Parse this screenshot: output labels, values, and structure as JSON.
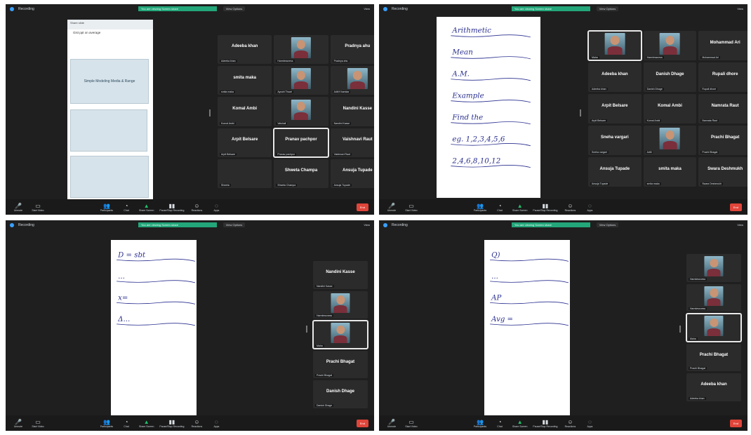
{
  "meeting": {
    "app_label": "Recording",
    "view_pill": "View Options",
    "view_right": "View",
    "share_banner": "You are viewing Screen share"
  },
  "panels": [
    {
      "id": "tl",
      "slides": {
        "header": "Share slide",
        "title": "Gist ppt on average",
        "slide_text": "Simple Modeling Media & Range",
        "second_text": "",
        "third_text": ""
      },
      "tiles": [
        {
          "name": "Adeeba khan",
          "label": "Adeeba khan",
          "video": false
        },
        {
          "name": "",
          "label": "Harmlessness",
          "video": true
        },
        {
          "name": "Pradnya ahu",
          "label": "Pradnya ahu",
          "video": false
        },
        {
          "name": "smita maka",
          "label": "smita maka",
          "video": false
        },
        {
          "name": "",
          "label": "Ayushi Tiwari",
          "video": true
        },
        {
          "name": "",
          "label": "Aditi Khamkar",
          "video": true
        },
        {
          "name": "Komal Ambi",
          "label": "Komal Ambi",
          "video": false
        },
        {
          "name": "",
          "label": "Vaishali",
          "video": true
        },
        {
          "name": "Nandini Kasse",
          "label": "Nandini Kasse",
          "video": false
        },
        {
          "name": "Arpit Belsare",
          "label": "Arpit Belsare",
          "video": false
        },
        {
          "name": "Pranav pachpor",
          "label": "Pranav pachpor",
          "video": false,
          "active": true
        },
        {
          "name": "Vaishnavi Raut",
          "label": "Vaishnavi Raut",
          "video": false
        },
        {
          "name": "",
          "label": "Shweta",
          "video": false
        },
        {
          "name": "Shweta Champa",
          "label": "Shweta Champa",
          "video": false
        },
        {
          "name": "Ansuja Tupade",
          "label": "Ansuja Tupade",
          "video": false
        }
      ]
    },
    {
      "id": "tr",
      "whiteboard": [
        "Arithmetic",
        "Mean",
        "A.M.",
        "Example",
        "Find the",
        "eg. 1,2,3,4,5,6",
        "2,4,6,8,10,12"
      ],
      "tiles": [
        {
          "name": "",
          "label": "Maha",
          "video": true,
          "active": true
        },
        {
          "name": "",
          "label": "Harmlessness",
          "video": true
        },
        {
          "name": "Mohammad Ari",
          "label": "Mohammad Ari",
          "video": false
        },
        {
          "name": "Adeeba khan",
          "label": "Adeeba khan",
          "video": false
        },
        {
          "name": "Danish Dhage",
          "label": "Danish Dhage",
          "video": false
        },
        {
          "name": "Rupali dhore",
          "label": "Rupali dhore",
          "video": false
        },
        {
          "name": "Arpit Belsare",
          "label": "Arpit Belsare",
          "video": false
        },
        {
          "name": "Komal Ambi",
          "label": "Komal Ambi",
          "video": false
        },
        {
          "name": "Namrata Raut",
          "label": "Namrata Raut",
          "video": false
        },
        {
          "name": "Sneha vargari",
          "label": "Sneha vargari",
          "video": false
        },
        {
          "name": "",
          "label": "Aditi",
          "video": true
        },
        {
          "name": "Prachi Bhagat",
          "label": "Prachi Bhagat",
          "video": false
        },
        {
          "name": "Ansuja Tupade",
          "label": "Ansuja Tupade",
          "video": false
        },
        {
          "name": "smita maka",
          "label": "smita maka",
          "video": false
        },
        {
          "name": "Swara Deshmukh",
          "label": "Swara Deshmukh",
          "video": false
        }
      ]
    },
    {
      "id": "bl",
      "whiteboard": [
        "D = sbt",
        "...",
        "x=",
        "Δ..."
      ],
      "tiles": [
        {
          "name": "Nandini Kasse",
          "label": "Nandini Kasse",
          "video": false
        },
        {
          "name": "",
          "label": "Harmlessness",
          "video": true
        },
        {
          "name": "",
          "label": "Maha",
          "video": true,
          "active": true
        },
        {
          "name": "Prachi Bhagat",
          "label": "Prachi Bhagat",
          "video": false
        },
        {
          "name": "Danish Dhage",
          "label": "Danish Dhage",
          "video": false
        }
      ]
    },
    {
      "id": "br",
      "whiteboard": [
        "Q)",
        "...",
        "AP",
        "Avg ="
      ],
      "tiles": [
        {
          "name": "",
          "label": "Harmlessness",
          "video": true
        },
        {
          "name": "",
          "label": "Harmlessness",
          "video": true
        },
        {
          "name": "",
          "label": "Maha",
          "video": true,
          "active": true
        },
        {
          "name": "Prachi Bhagat",
          "label": "Prachi Bhagat",
          "video": false
        },
        {
          "name": "Adeeba khan",
          "label": "Adeeba khan",
          "video": false
        }
      ]
    }
  ],
  "toolbar": {
    "mute": "Unmute",
    "video": "Start Video",
    "participants": "Participants",
    "chat": "Chat",
    "share": "Share Screen",
    "record": "Pause/Stop Recording",
    "reactions": "Reactions",
    "apps": "Apps",
    "end": "End"
  },
  "colors": {
    "accent_green": "#21c06a",
    "end_red": "#e0453a",
    "share_banner": "#23a67a"
  }
}
